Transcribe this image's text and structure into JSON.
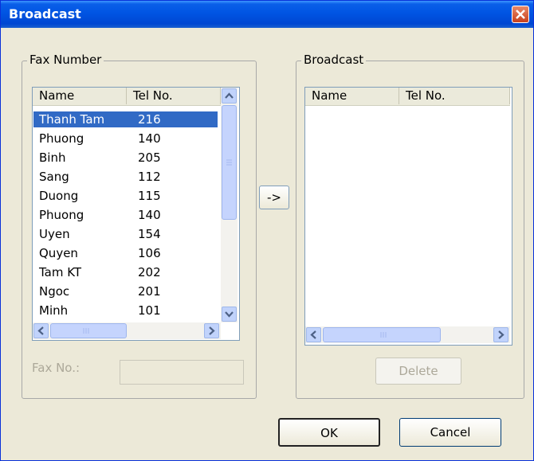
{
  "window": {
    "title": "Broadcast"
  },
  "fax_group": {
    "label": "Fax Number",
    "columns": [
      "Name",
      "Tel No."
    ],
    "rows": [
      {
        "name": "Thanh Tam",
        "tel": "216",
        "selected": true
      },
      {
        "name": "Phuong",
        "tel": "140"
      },
      {
        "name": "Binh",
        "tel": "205"
      },
      {
        "name": "Sang",
        "tel": "112"
      },
      {
        "name": "Duong",
        "tel": "115"
      },
      {
        "name": "Phuong",
        "tel": "140"
      },
      {
        "name": "Uyen",
        "tel": "154"
      },
      {
        "name": "Quyen",
        "tel": "106"
      },
      {
        "name": "Tam KT",
        "tel": "202"
      },
      {
        "name": "Ngoc",
        "tel": "201"
      },
      {
        "name": "Minh",
        "tel": "101"
      }
    ],
    "fax_no_label": "Fax No.:",
    "fax_no_value": ""
  },
  "transfer_button": "->",
  "broadcast_group": {
    "label": "Broadcast",
    "columns": [
      "Name",
      "Tel No."
    ],
    "delete_label": "Delete"
  },
  "buttons": {
    "ok": "OK",
    "cancel": "Cancel"
  },
  "colors": {
    "title_bar": "#0054e3",
    "selection": "#316ac5",
    "dialog_bg": "#ece9d8"
  }
}
